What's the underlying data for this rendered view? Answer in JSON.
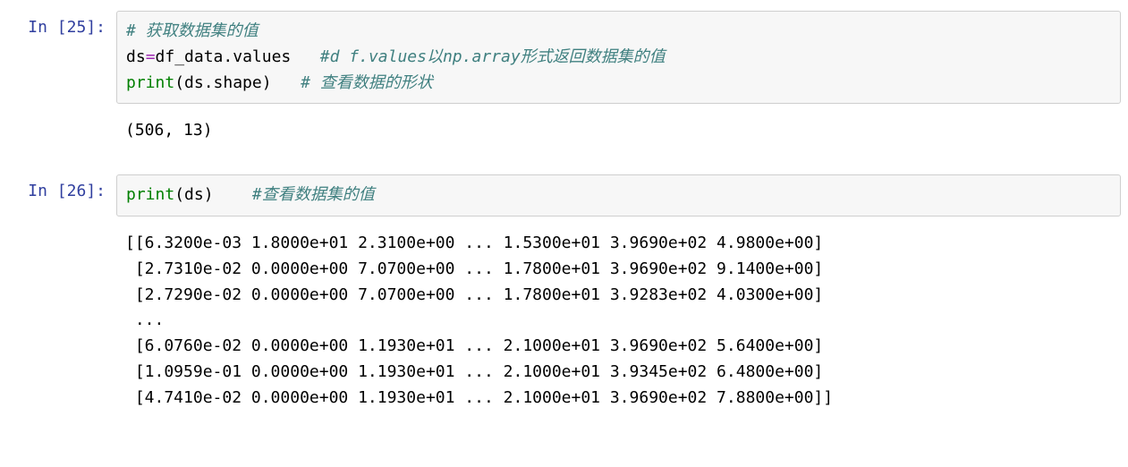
{
  "cells": {
    "c25": {
      "prompt": "In [25]:",
      "code": {
        "line1_comment": "# 获取数据集的值",
        "line2_plain": "ds",
        "line2_op": "=",
        "line2_rest": "df_data.values   ",
        "line2_comment": "#d f.values以np.array形式返回数据集的值",
        "line3_builtin": "print",
        "line3_rest": "(ds.shape)   ",
        "line3_comment": "# 查看数据的形状"
      },
      "output": "(506, 13)"
    },
    "c26": {
      "prompt": "In [26]:",
      "code": {
        "line1_builtin": "print",
        "line1_rest": "(ds)    ",
        "line1_comment": "#查看数据集的值"
      },
      "output": "[[6.3200e-03 1.8000e+01 2.3100e+00 ... 1.5300e+01 3.9690e+02 4.9800e+00]\n [2.7310e-02 0.0000e+00 7.0700e+00 ... 1.7800e+01 3.9690e+02 9.1400e+00]\n [2.7290e-02 0.0000e+00 7.0700e+00 ... 1.7800e+01 3.9283e+02 4.0300e+00]\n ...\n [6.0760e-02 0.0000e+00 1.1930e+01 ... 2.1000e+01 3.9690e+02 5.6400e+00]\n [1.0959e-01 0.0000e+00 1.1930e+01 ... 2.1000e+01 3.9345e+02 6.4800e+00]\n [4.7410e-02 0.0000e+00 1.1930e+01 ... 2.1000e+01 3.9690e+02 7.8800e+00]]"
    }
  }
}
